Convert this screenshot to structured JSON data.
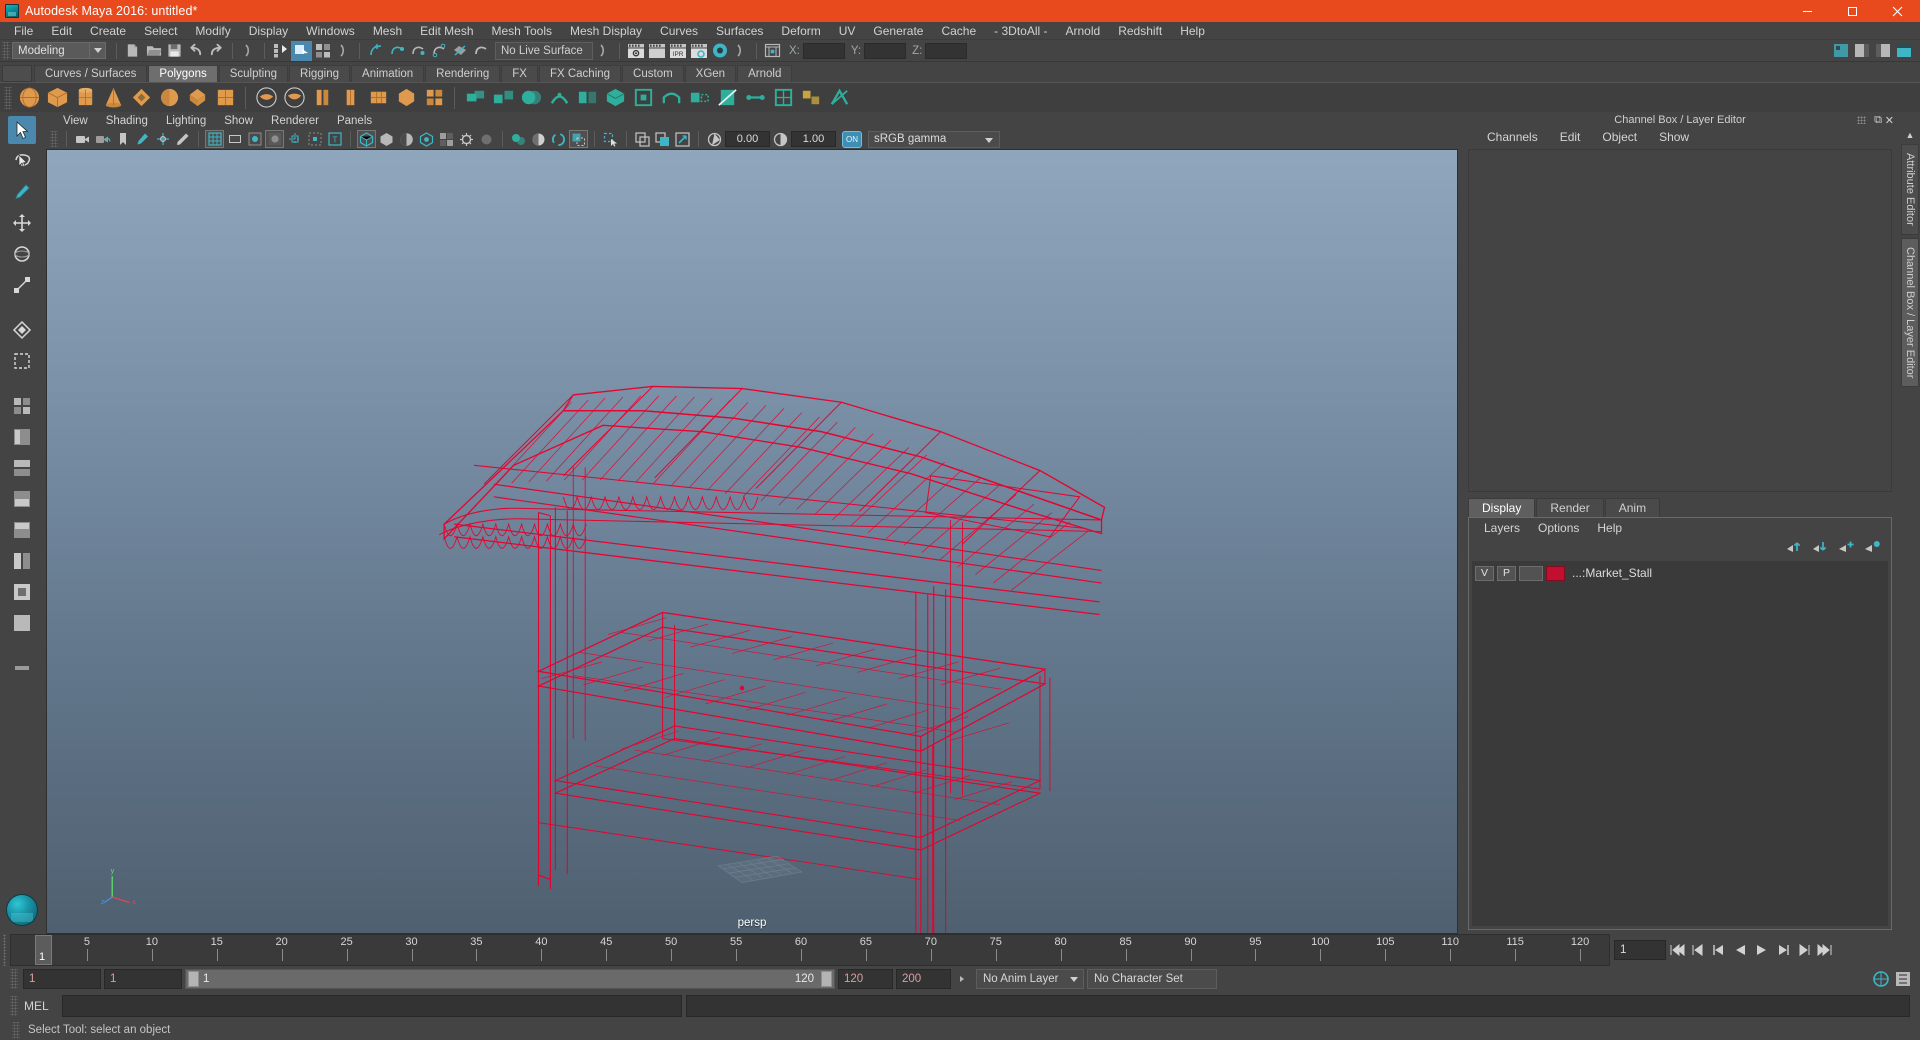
{
  "window": {
    "title": "Autodesk Maya 2016: untitled*",
    "app_icon": "maya-logo-icon",
    "minimize": "minimize-button",
    "maximize": "maximize-button",
    "close": "close-button",
    "titlebar_color": "#e8491d"
  },
  "menubar": {
    "items": [
      "File",
      "Edit",
      "Create",
      "Select",
      "Modify",
      "Display",
      "Windows",
      "Mesh",
      "Edit Mesh",
      "Mesh Tools",
      "Mesh Display",
      "Curves",
      "Surfaces",
      "Deform",
      "UV",
      "Generate",
      "Cache",
      "- 3DtoAll -",
      "Arnold",
      "Redshift",
      "Help"
    ]
  },
  "statusline": {
    "mode_menu": "Modeling",
    "live_surface": "No Live Surface",
    "coord_labels": {
      "x": "X:",
      "y": "Y:",
      "z": "Z:"
    },
    "coord_values": {
      "x": "",
      "y": "",
      "z": ""
    },
    "icons": [
      "new-scene-icon",
      "open-scene-icon",
      "save-scene-icon",
      "undo-icon",
      "redo-icon",
      "select-by-hierarchy-icon",
      "select-by-object-icon",
      "select-by-component-icon",
      "snap-to-grid-icon",
      "snap-to-curve-icon",
      "snap-to-point-icon",
      "snap-to-projected-center-icon",
      "snap-to-view-plane-icon",
      "make-live-icon",
      "render-view-icon",
      "render-current-frame-icon",
      "ipr-render-icon",
      "render-settings-icon",
      "hypershade-icon",
      "open-editor-icon"
    ]
  },
  "shelf": {
    "tabs": [
      "Curves / Surfaces",
      "Polygons",
      "Sculpting",
      "Rigging",
      "Animation",
      "Rendering",
      "FX",
      "FX Caching",
      "Custom",
      "XGen",
      "Arnold"
    ],
    "active_tab": "Polygons",
    "icons": [
      "poly-sphere-icon",
      "poly-cube-icon",
      "poly-cylinder-icon",
      "poly-cone-icon",
      "poly-torus-icon",
      "poly-plane-icon",
      "poly-disc-icon",
      "poly-platonic-icon",
      "poly-pyramid-icon",
      "poly-prism-icon",
      "poly-pipe-icon",
      "poly-helix-icon",
      "poly-gear-icon",
      "poly-soccer-ball-icon",
      "poly-super-ellipse-icon",
      "combine-icon",
      "separate-icon",
      "booleans-icon",
      "smooth-icon",
      "mirror-icon",
      "extrude-icon",
      "bevel-icon",
      "bridge-icon",
      "append-polygon-icon",
      "wedge-icon",
      "multi-cut-icon",
      "target-weld-icon",
      "quad-draw-icon",
      "sculpt-icon",
      "crease-icon"
    ]
  },
  "toolbox": {
    "tools": [
      "select-tool",
      "lasso-select-tool",
      "paint-select-tool",
      "move-tool",
      "rotate-tool",
      "scale-tool",
      "soft-modification-tool",
      "show-manipulator-tool",
      "last-tool-used"
    ],
    "layout_presets": [
      "single-perspective-view",
      "four-view-layout",
      "persp-outliner-layout",
      "persp-graph-editor-layout",
      "hypershade-persp-layout",
      "persp-hypergraph-layout",
      "outliner-persp-layout",
      "persp-only-layout"
    ],
    "bookmark": "maya-logo-orb"
  },
  "viewport": {
    "menus": [
      "View",
      "Shading",
      "Lighting",
      "Show",
      "Renderer",
      "Panels"
    ],
    "camera_label": "persp",
    "toolbar": {
      "exposure_value": "0.00",
      "gamma_value": "1.00",
      "color_management": "sRGB gamma",
      "color_management_toggle": "ON",
      "icons": [
        "select-camera-icon",
        "lock-camera-icon",
        "bookmarks-icon",
        "image-plane-icon",
        "two-d-pan-zoom-icon",
        "grease-pencil-icon",
        "grid-icon",
        "film-gate-icon",
        "resolution-gate-icon",
        "gate-mask-icon",
        "film-origin-icon",
        "safe-action-icon",
        "field-chart-icon",
        "wireframe-icon",
        "smooth-shade-icon",
        "shaded-wireframe-icon",
        "textured-icon",
        "lighting-icon",
        "shadows-icon",
        "ambient-occlusion-icon",
        "motion-blur-icon",
        "multisample-icon",
        "xray-icon",
        "xray-joints-icon",
        "isolate-select-icon",
        "no-manipulator-icon",
        "panel-zoom-icon",
        "grab-icon",
        "exposure-icon",
        "gamma-icon"
      ]
    },
    "axis_gizmo": {
      "x": "x",
      "y": "y",
      "z": "z"
    },
    "model_name": "Market_Stall",
    "wireframe_color": "#e8002d"
  },
  "channelbox": {
    "panel_title": "Channel Box / Layer Editor",
    "tabs": [
      "Channels",
      "Edit",
      "Object",
      "Show"
    ],
    "rows": []
  },
  "layer_editor": {
    "tabs": [
      "Display",
      "Render",
      "Anim"
    ],
    "active_tab": "Display",
    "menus": [
      "Layers",
      "Options",
      "Help"
    ],
    "toolbar_icons": [
      "move-layer-up-icon",
      "move-layer-down-icon",
      "new-layer-icon",
      "new-layer-from-selected-icon"
    ],
    "layers": [
      {
        "visibility": "V",
        "playback": "P",
        "state": "",
        "color": "#c20f2f",
        "name": "...:Market_Stall"
      }
    ]
  },
  "right_vtabs": {
    "items": [
      "Attribute Editor",
      "Channel Box / Layer Editor"
    ],
    "active": "Channel Box / Layer Editor"
  },
  "timeline": {
    "ticks": [
      5,
      10,
      15,
      20,
      25,
      30,
      35,
      40,
      45,
      50,
      55,
      60,
      65,
      70,
      75,
      80,
      85,
      90,
      95,
      100,
      105,
      110,
      115,
      120
    ],
    "current_frame_marker": "1",
    "current_frame_field": "1",
    "playback_icons": [
      "go-to-start-icon",
      "step-back-keyframe-icon",
      "step-back-frame-icon",
      "play-backwards-icon",
      "play-forwards-icon",
      "step-forward-frame-icon",
      "step-forward-keyframe-icon",
      "go-to-end-icon"
    ]
  },
  "range_slider": {
    "anim_start": "1",
    "range_start": "1",
    "bar_start_label": "1",
    "bar_end_label": "120",
    "range_end": "120",
    "anim_end": "200",
    "anim_layer": "No Anim Layer",
    "character_set": "No Character Set",
    "auto_key_icon": "auto-keyframe-icon",
    "anim_prefs_icon": "animation-preferences-icon"
  },
  "command_line": {
    "language_label": "MEL",
    "input_value": "",
    "output_value": ""
  },
  "status": {
    "help_text": "Select Tool: select an object"
  }
}
